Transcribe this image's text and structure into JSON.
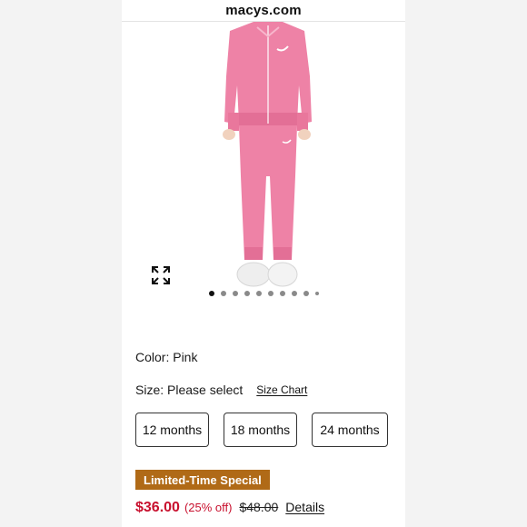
{
  "header": {
    "domain": "macys.com"
  },
  "gallery": {
    "dot_count": 10,
    "active_index": 0,
    "expand_icon": "expand-icon"
  },
  "product": {
    "color_label": "Color: Pink",
    "size_label": "Size: Please select",
    "size_chart_link": "Size Chart",
    "sizes": [
      "12 months",
      "18 months",
      "24 months"
    ],
    "promo_badge": "Limited-Time Special",
    "price_now": "$36.00",
    "discount": "(25% off)",
    "price_was": "$48.00",
    "details_link": "Details"
  },
  "colors": {
    "sale_red": "#c8102e",
    "badge_bg": "#b06a17",
    "garment_pink": "#ee82a6"
  }
}
